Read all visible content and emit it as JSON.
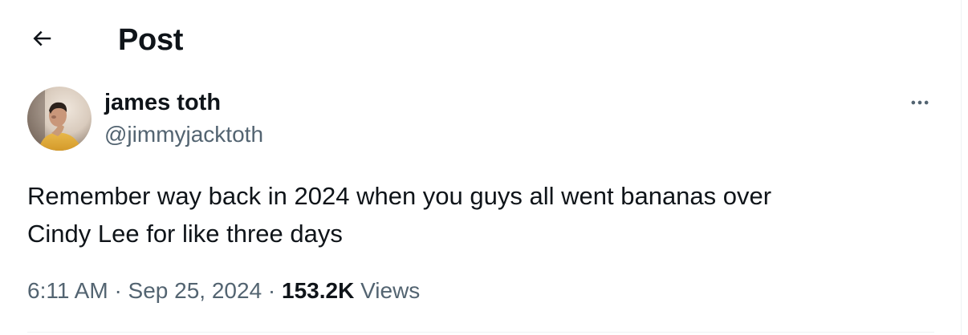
{
  "header": {
    "back_icon": "arrow-left-icon",
    "title": "Post"
  },
  "author": {
    "avatar_icon": "user-avatar-photo",
    "display_name": "james toth",
    "handle": "@jimmyjacktoth"
  },
  "more_icon": "more-horizontal-icon",
  "tweet": {
    "text_line1": "Remember way back in 2024 when you guys all went bananas over",
    "text_line2": "Cindy Lee for like three days"
  },
  "meta": {
    "time": "6:11 AM",
    "separator": "·",
    "date": "Sep 25, 2024",
    "views_count": "153.2K",
    "views_label": "Views"
  },
  "colors": {
    "text_primary": "#0f1419",
    "text_secondary": "#536471",
    "divider": "#eff3f4",
    "background": "#ffffff"
  }
}
